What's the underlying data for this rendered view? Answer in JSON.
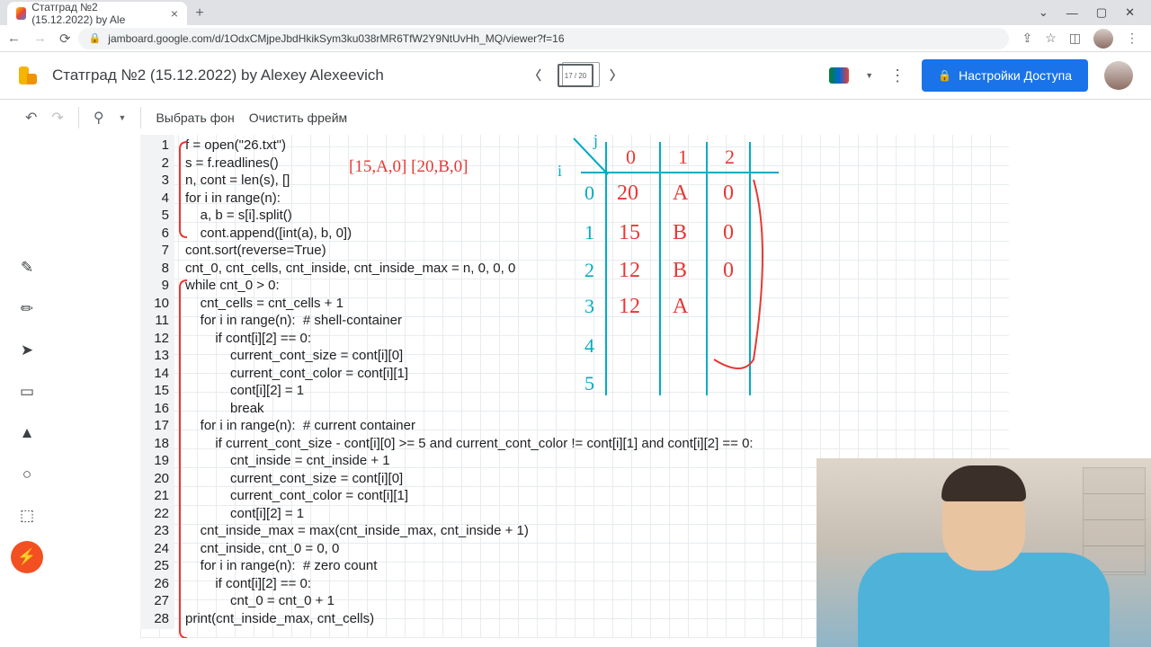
{
  "browser": {
    "tab_title": "Статград №2 (15.12.2022) by Ale",
    "url": "jamboard.google.com/d/1OdxCMjpeJbdHkikSym3ku038rMR6TfW2Y9NtUvHh_MQ/viewer?f=16"
  },
  "header": {
    "title": "Статград №2 (15.12.2022) by Alexey Alexeevich",
    "frame_indicator": "17 / 20",
    "share_label": "Настройки Доступа"
  },
  "toolbar": {
    "background_btn": "Выбрать фон",
    "clear_btn": "Очистить фрейм"
  },
  "code": {
    "lines": [
      "f = open(\"26.txt\")",
      "s = f.readlines()",
      "n, cont = len(s), []",
      "for i in range(n):",
      "    a, b = s[i].split()",
      "    cont.append([int(a), b, 0])",
      "cont.sort(reverse=True)",
      "cnt_0, cnt_cells, cnt_inside, cnt_inside_max = n, 0, 0, 0",
      "while cnt_0 > 0:",
      "    cnt_cells = cnt_cells + 1",
      "    for i in range(n):  # shell-container",
      "        if cont[i][2] == 0:",
      "            current_cont_size = cont[i][0]",
      "            current_cont_color = cont[i][1]",
      "            cont[i][2] = 1",
      "            break",
      "    for i in range(n):  # current container",
      "        if current_cont_size - cont[i][0] >= 5 and current_cont_color != cont[i][1] and cont[i][2] == 0:",
      "            cnt_inside = cnt_inside + 1",
      "            current_cont_size = cont[i][0]",
      "            current_cont_color = cont[i][1]",
      "            cont[i][2] = 1",
      "    cnt_inside_max = max(cnt_inside_max, cnt_inside + 1)",
      "    cnt_inside, cnt_0 = 0, 0",
      "    for i in range(n):  # zero count",
      "        if cont[i][2] == 0:",
      "            cnt_0 = cnt_0 + 1",
      "print(cnt_inside_max, cnt_cells)"
    ]
  },
  "annotations": {
    "array_note": "[15,A,0] [20,B,0]",
    "table": {
      "col_headers": [
        "0",
        "1",
        "2"
      ],
      "row_headers": [
        "0",
        "1",
        "2",
        "3",
        "4",
        "5"
      ],
      "rows": [
        [
          "20",
          "A",
          "0"
        ],
        [
          "15",
          "B",
          "0"
        ],
        [
          "12",
          "B",
          "0"
        ],
        [
          "12",
          "A",
          ""
        ]
      ]
    },
    "axis_i": "i",
    "axis_j": "j"
  }
}
